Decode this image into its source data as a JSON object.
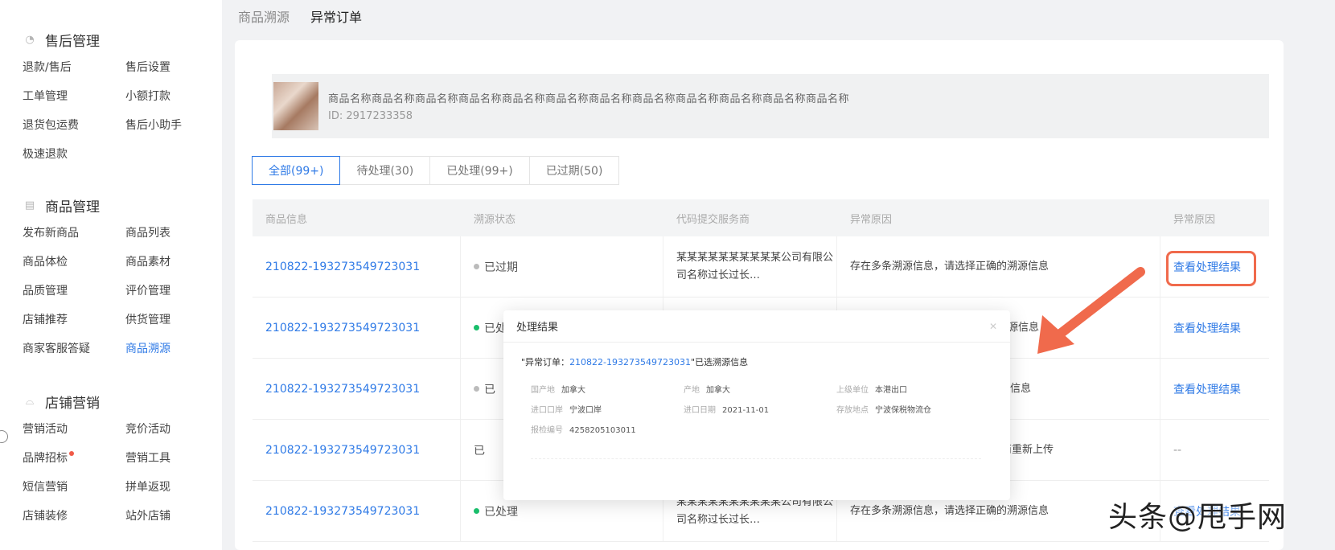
{
  "sidebar": {
    "sections": [
      {
        "title": "售后管理",
        "icon": "clock-icon",
        "items": [
          "退款/售后",
          "售后设置",
          "工单管理",
          "小额打款",
          "退货包运费",
          "售后小助手",
          "极速退款"
        ]
      },
      {
        "title": "商品管理",
        "icon": "document-icon",
        "items": [
          "发布新商品",
          "商品列表",
          "商品体检",
          "商品素材",
          "品质管理",
          "评价管理",
          "店铺推荐",
          "供货管理",
          "商家客服答疑",
          "商品溯源"
        ],
        "active": "商品溯源"
      },
      {
        "title": "店铺营销",
        "icon": "shopping-bag-icon",
        "items": [
          "营销活动",
          "竞价活动",
          "品牌招标",
          "营销工具",
          "短信营销",
          "拼单返现",
          "店铺装修",
          "站外店铺"
        ]
      }
    ]
  },
  "breadcrumb": {
    "parent": "商品溯源",
    "current": "异常订单"
  },
  "product": {
    "name": "商品名称商品名称商品名称商品名称商品名称商品名称商品名称商品名称商品名称商品名称商品名称商品名称",
    "id": "ID: 2917233358"
  },
  "tabs": [
    "全部(99+)",
    "待处理(30)",
    "已处理(99+)",
    "已过期(50)"
  ],
  "table": {
    "headers": [
      "商品信息",
      "溯源状态",
      "代码提交服务商",
      "异常原因",
      "异常原因"
    ],
    "rows": [
      {
        "order": "210822-193273549723031",
        "status": "已过期",
        "provider": "某某某某某某某某某某公司有限公司名称过长过长…",
        "reason": "存在多条溯源信息，请选择正确的溯源信息",
        "reason_sub": "",
        "action": "查看处理结果"
      },
      {
        "order": "210822-193273549723031",
        "status": "已处理",
        "provider": "",
        "reason": "确的溯源信息",
        "reason_sub": "",
        "action": "查看处理结果"
      },
      {
        "order": "210822-193273549723031",
        "status": "已",
        "provider": "",
        "reason": "确的溯源信息",
        "reason_sub": "",
        "action": "查看处理结果"
      },
      {
        "order": "210822-193273549723031",
        "status": "已",
        "provider": "",
        "reason": "服务商重新上传",
        "reason_sub": "",
        "action": "--"
      },
      {
        "order": "210822-193273549723031",
        "status": "已处理",
        "provider": "某某某某某某某某某某公司有限公司名称过长过长…",
        "reason": "存在多条溯源信息，请选择正确的溯源信息",
        "reason_sub": "",
        "action": "查看处理结果"
      }
    ]
  },
  "modal": {
    "title": "处理结果",
    "line_prefix": "\"异常订单：",
    "line_link": "210822-193273549723031",
    "line_suffix": "\"已选溯源信息",
    "fields": [
      {
        "label": "国产地",
        "value": "加拿大"
      },
      {
        "label": "产地",
        "value": "加拿大"
      },
      {
        "label": "上级单位",
        "value": "本港出口"
      },
      {
        "label": "进口口岸",
        "value": "宁波口岸"
      },
      {
        "label": "进口日期",
        "value": "2021-11-01"
      },
      {
        "label": "存放地点",
        "value": "宁波保税物流仓"
      },
      {
        "label": "报检编号",
        "value": "4258205103011"
      }
    ]
  },
  "watermark": "头条@甩手网",
  "colors": {
    "link": "#2f7ae6",
    "highlight": "#f06a4c",
    "status_green": "#19be6b"
  }
}
